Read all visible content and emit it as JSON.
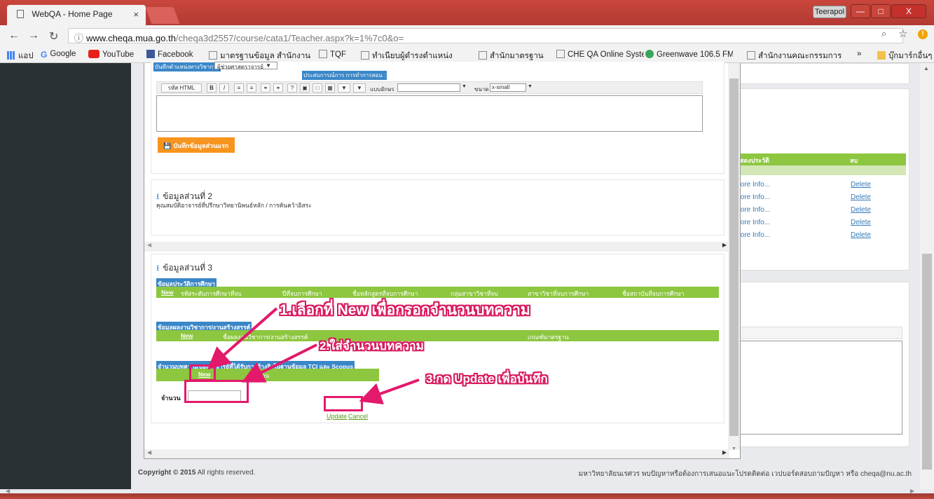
{
  "browser": {
    "tab_title": "WebQA - Home Page",
    "tab_close": "×",
    "user_label": "Teerapol",
    "url_host": "www.cheqa.mua.go.th",
    "url_path": "/cheqa3d2557/course/cata1/Teacher.aspx?k=1%7c0&o=",
    "bookmarks": [
      {
        "label": "แอป",
        "icon": "apps-icon",
        "color": "#4285f4"
      },
      {
        "label": "Google",
        "icon": "google-icon",
        "color": "#4285f4"
      },
      {
        "label": "YouTube",
        "icon": "youtube-icon",
        "color": "#e62117"
      },
      {
        "label": "Facebook",
        "icon": "facebook-icon",
        "color": "#3b5998"
      },
      {
        "label": "มาตรฐานข้อมูล สำนักงาน",
        "icon": "page-icon",
        "color": "#888888"
      },
      {
        "label": "TQF",
        "icon": "page-icon",
        "color": "#888888"
      },
      {
        "label": "ทำเนียบผู้ดำรงตำแหน่ง",
        "icon": "page-icon",
        "color": "#888888"
      },
      {
        "label": "สำนักมาตรฐาน",
        "icon": "page-icon",
        "color": "#888888"
      },
      {
        "label": "CHE QA Online Syste",
        "icon": "page-icon",
        "color": "#888888"
      },
      {
        "label": "Greenwave 106.5 FM",
        "icon": "radio-icon",
        "color": "#3aa55b"
      },
      {
        "label": "สำนักงานคณะกรรมการ",
        "icon": "page-icon",
        "color": "#888888"
      },
      {
        "label": "»",
        "icon": "",
        "color": "#444444"
      },
      {
        "label": "บุ๊กมาร์กอื่นๆ",
        "icon": "folder-icon",
        "color": "#f2c14e"
      }
    ]
  },
  "background": {
    "table_header_1": "สดงประวัติ",
    "table_header_2": "ลบ",
    "rows": [
      {
        "more": "fore Info...",
        "delete": "Delete"
      },
      {
        "more": "fore Info...",
        "delete": "Delete"
      },
      {
        "more": "fore Info...",
        "delete": "Delete"
      },
      {
        "more": "fore Info...",
        "delete": "Delete"
      },
      {
        "more": "fore Info...",
        "delete": "Delete"
      }
    ],
    "footer_copyright_bold": "Copyright © 2015",
    "footer_copyright_rest": " All rights reserved.",
    "footer_contact": "มหาวิทยาลัยนเรศวร พบปัญหาหรือต้องการเสนอแนะโปรดติดต่อ เวปบอร์ดสอบถามปัญหา หรือ cheqa@nu.ac.th"
  },
  "modal": {
    "section1": {
      "rank_label": "บันทึกตำแหน่งทางวิชาการ",
      "rank_value": "ผู้ช่วยศาสตราจารย์",
      "experience_label": "ประสบการณ์การ การทำการสอน :",
      "toolbar": {
        "html_button": "รหัส HTML",
        "bold": "B",
        "italic": "I",
        "font_label": "แบบอักษร",
        "size_label": "ขนาด",
        "size_value": "x-small"
      },
      "save_button": "บันทึกข้อมูลส่วนแรก"
    },
    "section2": {
      "title": "ข้อมูลส่วนที่ 2",
      "subtitle": "คุณสมบัติอาจารย์ที่ปรึกษาวิทยานิพนธ์หลัก / การค้นคว้าอิสระ"
    },
    "section3": {
      "title": "ข้อมูลส่วนที่ 3",
      "education_label": "ข้อมูลประวัติการศึกษา",
      "education_headers": [
        "New",
        "รหัสระดับการศึกษาที่จบ",
        "ปีที่จบการศึกษา",
        "ชื่อหลักสูตรที่จบการศึกษา",
        "กลุ่มสาขาวิชาที่จบ",
        "สาขาวิชาที่จบการศึกษา",
        "ชื่อสถาบันที่จบการศึกษา"
      ],
      "works_label": "ข้อมูลผลงานวิชาการ/งานสร้างสรรค์",
      "works_headers": [
        "New",
        "ชื่อผลงานวิชาการ/งานสร้างสรรค์",
        "เกณฑ์มาตรฐาน"
      ],
      "articles_label": "จำนวนบทความของอาจารย์ที่ได้รับการอ้างอิงในฐานข้อมูล TCI และ Scopus",
      "articles_headers": [
        "New",
        "จำนวน"
      ],
      "amount_label": "จำนวน",
      "amount_value": "",
      "update_link": "Update",
      "cancel_link": "Cancel"
    }
  },
  "annotations": {
    "step1": "1.เลือกที่ New เพื่อกรอกจำนวนบทความ",
    "step2": "2.ใส่จำนวนบทความ",
    "step3": "3.กด Update เพื่อบันทึก",
    "accent_color": "#e3196b"
  }
}
